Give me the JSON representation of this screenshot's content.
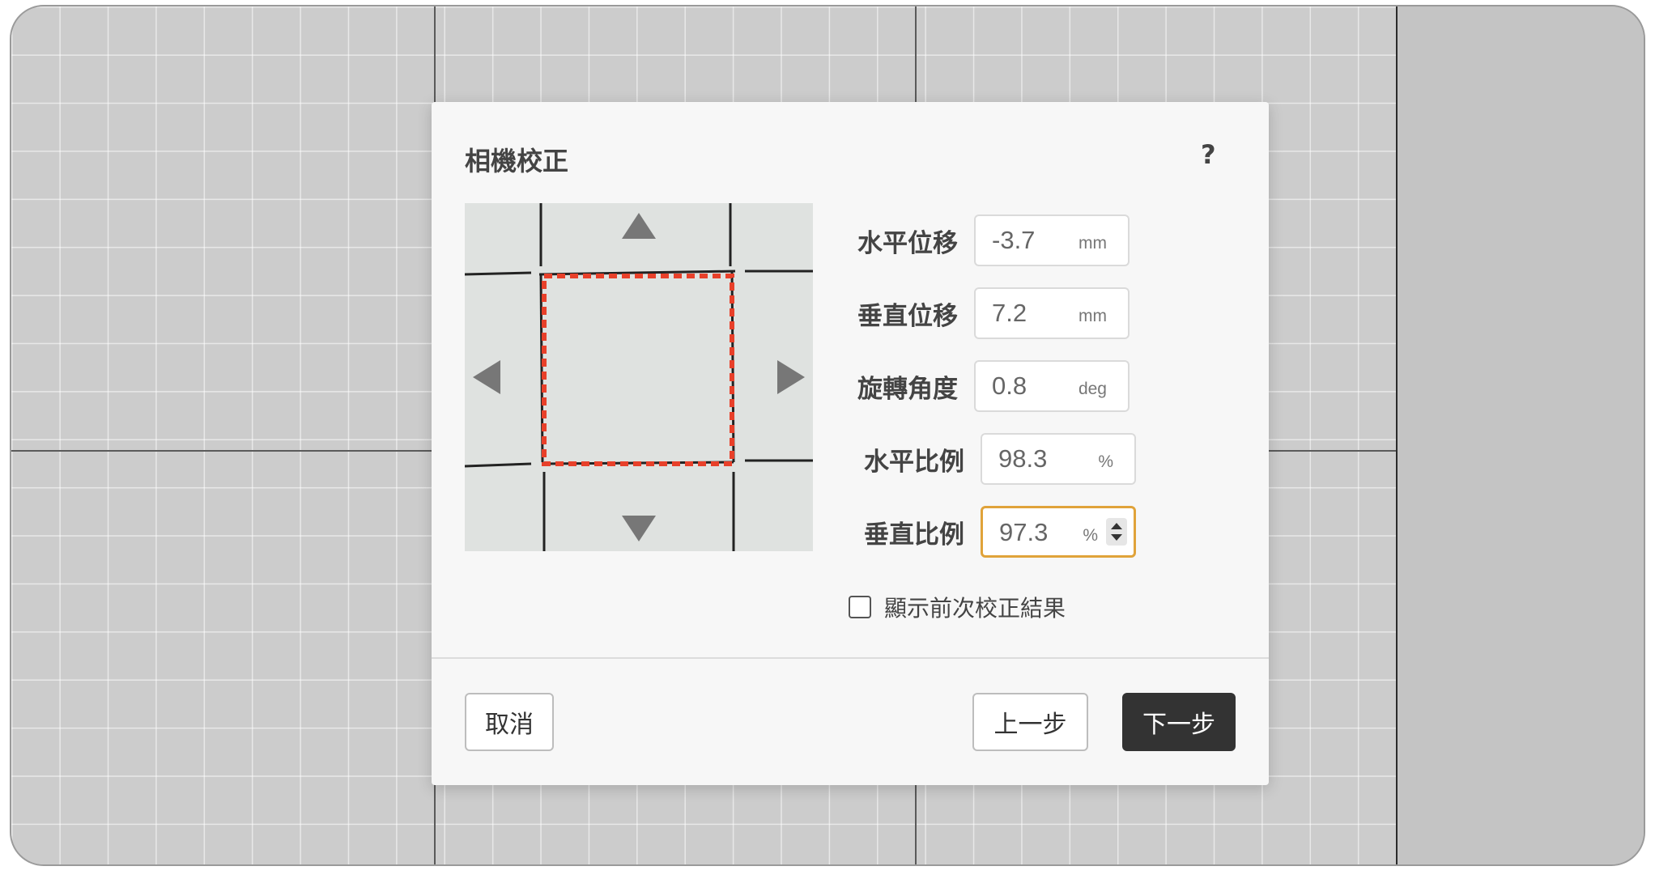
{
  "dialog": {
    "title": "相機校正",
    "help": "?"
  },
  "icons": {
    "help": "help-icon",
    "up": "arrow-up-icon",
    "down": "arrow-down-icon",
    "left": "arrow-left-icon",
    "right": "arrow-right-icon"
  },
  "form": {
    "rows": [
      {
        "label": "水平位移",
        "value": "-3.7",
        "unit": "mm"
      },
      {
        "label": "垂直位移",
        "value": "7.2",
        "unit": "mm"
      },
      {
        "label": "旋轉角度",
        "value": "0.8",
        "unit": "deg"
      },
      {
        "label": "水平比例",
        "value": "98.3",
        "unit": "%"
      },
      {
        "label": "垂直比例",
        "value": "97.3",
        "unit": "%"
      }
    ],
    "show_previous_label": "顯示前次校正結果",
    "show_previous_checked": false
  },
  "footer": {
    "cancel_label": "取消",
    "back_label": "上一步",
    "next_label": "下一步"
  },
  "colors": {
    "overlay_dashed": "#e8402a",
    "focus_border": "#e0a33a",
    "primary_button": "#333333"
  }
}
